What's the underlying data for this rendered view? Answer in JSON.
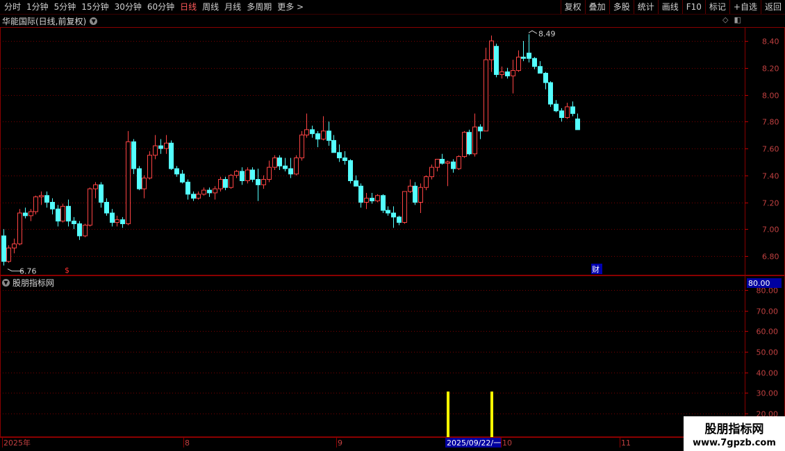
{
  "toolbar": {
    "tabs": [
      "分时",
      "1分钟",
      "5分钟",
      "15分钟",
      "30分钟",
      "60分钟",
      "日线",
      "周线",
      "月线",
      "多周期",
      "更多 >"
    ],
    "active_tab": "日线",
    "right_buttons": [
      "复权",
      "叠加",
      "多股",
      "统计",
      "画线",
      "F10",
      "标记",
      "+自选",
      "返回"
    ]
  },
  "main_chart": {
    "title": "华能国际(日线,前复权)",
    "y_ticks": [
      "8.40",
      "8.20",
      "8.00",
      "7.80",
      "7.60",
      "7.40",
      "7.20",
      "7.00",
      "6.80"
    ],
    "high_label": "8.49",
    "low_label": "6.76",
    "event_marker": "$",
    "finance_marker": "财"
  },
  "sub_chart": {
    "title": "股朋指标网",
    "current_value": "80.00",
    "y_ticks": [
      "80.00",
      "70.00",
      "60.00",
      "50.00",
      "40.00",
      "30.00",
      "20.00"
    ]
  },
  "x_axis": {
    "labels": [
      "2025年",
      "8",
      "9",
      "10",
      "11"
    ],
    "cursor_date": "2025/09/22/一"
  },
  "watermark": {
    "line1": "股朋指标网",
    "line2": "www.7gpzb.com"
  },
  "colors": {
    "background": "#000000",
    "up": "#ff4444",
    "down": "#54ffff",
    "grid": "#7a0000",
    "signal": "#ffff00"
  },
  "chart_data": {
    "type": "candlestick",
    "ylim": [
      6.76,
      8.49
    ],
    "candles": [
      [
        6.95,
        7.0,
        6.73,
        6.76
      ],
      [
        6.76,
        6.88,
        6.75,
        6.86
      ],
      [
        6.86,
        6.93,
        6.82,
        6.89
      ],
      [
        6.89,
        7.15,
        6.88,
        7.12
      ],
      [
        7.12,
        7.16,
        7.08,
        7.1
      ],
      [
        7.1,
        7.15,
        7.06,
        7.13
      ],
      [
        7.13,
        7.25,
        7.11,
        7.24
      ],
      [
        7.24,
        7.28,
        7.18,
        7.25
      ],
      [
        7.25,
        7.28,
        7.16,
        7.2
      ],
      [
        7.2,
        7.23,
        7.11,
        7.15
      ],
      [
        7.15,
        7.18,
        7.02,
        7.06
      ],
      [
        7.06,
        7.19,
        7.05,
        7.17
      ],
      [
        7.17,
        7.22,
        7.02,
        7.06
      ],
      [
        7.06,
        7.09,
        7.0,
        7.04
      ],
      [
        7.04,
        7.06,
        6.92,
        6.95
      ],
      [
        6.95,
        7.04,
        6.94,
        7.03
      ],
      [
        7.03,
        7.31,
        7.02,
        7.3
      ],
      [
        7.3,
        7.35,
        7.23,
        7.33
      ],
      [
        7.33,
        7.35,
        7.16,
        7.2
      ],
      [
        7.2,
        7.23,
        7.1,
        7.12
      ],
      [
        7.12,
        7.15,
        7.02,
        7.05
      ],
      [
        7.05,
        7.1,
        7.02,
        7.07
      ],
      [
        7.07,
        7.09,
        7.01,
        7.04
      ],
      [
        7.04,
        7.73,
        7.03,
        7.65
      ],
      [
        7.65,
        7.67,
        7.41,
        7.45
      ],
      [
        7.45,
        7.47,
        7.29,
        7.3
      ],
      [
        7.3,
        7.4,
        7.23,
        7.38
      ],
      [
        7.38,
        7.58,
        7.37,
        7.55
      ],
      [
        7.55,
        7.7,
        7.52,
        7.62
      ],
      [
        7.62,
        7.67,
        7.56,
        7.6
      ],
      [
        7.6,
        7.7,
        7.56,
        7.64
      ],
      [
        7.64,
        7.66,
        7.44,
        7.45
      ],
      [
        7.45,
        7.47,
        7.39,
        7.41
      ],
      [
        7.41,
        7.44,
        7.34,
        7.35
      ],
      [
        7.35,
        7.37,
        7.22,
        7.26
      ],
      [
        7.26,
        7.28,
        7.21,
        7.23
      ],
      [
        7.23,
        7.28,
        7.22,
        7.26
      ],
      [
        7.26,
        7.31,
        7.25,
        7.29
      ],
      [
        7.29,
        7.31,
        7.24,
        7.27
      ],
      [
        7.27,
        7.32,
        7.22,
        7.3
      ],
      [
        7.3,
        7.39,
        7.28,
        7.37
      ],
      [
        7.37,
        7.39,
        7.29,
        7.31
      ],
      [
        7.31,
        7.41,
        7.3,
        7.4
      ],
      [
        7.4,
        7.44,
        7.38,
        7.43
      ],
      [
        7.43,
        7.46,
        7.33,
        7.36
      ],
      [
        7.36,
        7.46,
        7.34,
        7.44
      ],
      [
        7.44,
        7.46,
        7.35,
        7.37
      ],
      [
        7.37,
        7.45,
        7.21,
        7.33
      ],
      [
        7.33,
        7.4,
        7.3,
        7.37
      ],
      [
        7.37,
        7.51,
        7.35,
        7.46
      ],
      [
        7.46,
        7.55,
        7.44,
        7.53
      ],
      [
        7.53,
        7.55,
        7.44,
        7.47
      ],
      [
        7.47,
        7.53,
        7.43,
        7.45
      ],
      [
        7.45,
        7.53,
        7.38,
        7.41
      ],
      [
        7.41,
        7.55,
        7.4,
        7.53
      ],
      [
        7.53,
        7.73,
        7.51,
        7.7
      ],
      [
        7.7,
        7.86,
        7.68,
        7.74
      ],
      [
        7.74,
        7.77,
        7.68,
        7.71
      ],
      [
        7.71,
        7.73,
        7.61,
        7.67
      ],
      [
        7.67,
        7.84,
        7.66,
        7.73
      ],
      [
        7.73,
        7.8,
        7.62,
        7.66
      ],
      [
        7.66,
        7.7,
        7.57,
        7.57
      ],
      [
        7.57,
        7.63,
        7.5,
        7.53
      ],
      [
        7.53,
        7.58,
        7.48,
        7.51
      ],
      [
        7.51,
        7.52,
        7.34,
        7.36
      ],
      [
        7.36,
        7.4,
        7.32,
        7.32
      ],
      [
        7.32,
        7.34,
        7.16,
        7.2
      ],
      [
        7.2,
        7.27,
        7.15,
        7.23
      ],
      [
        7.23,
        7.27,
        7.19,
        7.21
      ],
      [
        7.21,
        7.26,
        7.2,
        7.25
      ],
      [
        7.25,
        7.26,
        7.12,
        7.14
      ],
      [
        7.14,
        7.17,
        7.1,
        7.12
      ],
      [
        7.12,
        7.17,
        7.01,
        7.09
      ],
      [
        7.09,
        7.1,
        7.03,
        7.05
      ],
      [
        7.05,
        7.28,
        7.04,
        7.28
      ],
      [
        7.28,
        7.37,
        7.27,
        7.32
      ],
      [
        7.32,
        7.35,
        7.18,
        7.2
      ],
      [
        7.2,
        7.34,
        7.12,
        7.31
      ],
      [
        7.31,
        7.4,
        7.29,
        7.39
      ],
      [
        7.39,
        7.48,
        7.37,
        7.46
      ],
      [
        7.46,
        7.52,
        7.43,
        7.52
      ],
      [
        7.52,
        7.56,
        7.48,
        7.49
      ],
      [
        7.49,
        7.51,
        7.32,
        7.5
      ],
      [
        7.5,
        7.52,
        7.42,
        7.45
      ],
      [
        7.45,
        7.55,
        7.44,
        7.54
      ],
      [
        7.54,
        7.73,
        7.53,
        7.72
      ],
      [
        7.72,
        7.74,
        7.55,
        7.56
      ],
      [
        7.56,
        7.86,
        7.54,
        7.76
      ],
      [
        7.76,
        7.78,
        7.67,
        7.73
      ],
      [
        7.73,
        8.35,
        7.97,
        8.26
      ],
      [
        8.26,
        8.44,
        8.17,
        8.4
      ],
      [
        8.36,
        8.38,
        8.13,
        8.15
      ],
      [
        8.15,
        8.21,
        8.12,
        8.17
      ],
      [
        8.17,
        8.2,
        8.12,
        8.14
      ],
      [
        8.14,
        8.26,
        8.01,
        8.18
      ],
      [
        8.18,
        8.33,
        8.17,
        8.28
      ],
      [
        8.28,
        8.4,
        8.25,
        8.27
      ],
      [
        8.31,
        8.45,
        8.24,
        8.27
      ],
      [
        8.27,
        8.28,
        8.19,
        8.21
      ],
      [
        8.21,
        8.25,
        8.16,
        8.16
      ],
      [
        8.16,
        8.17,
        8.04,
        8.09
      ],
      [
        8.09,
        8.1,
        7.91,
        7.93
      ],
      [
        7.93,
        7.96,
        7.87,
        7.88
      ],
      [
        7.88,
        7.9,
        7.8,
        7.83
      ],
      [
        7.83,
        7.94,
        7.82,
        7.91
      ],
      [
        7.91,
        7.95,
        7.84,
        7.86
      ],
      [
        7.82,
        7.86,
        7.75,
        7.74
      ]
    ],
    "indicator": {
      "name": "股朋指标网",
      "ylim": [
        15,
        90
      ],
      "signals": [
        "2025/09/22",
        "2025/09/26"
      ]
    }
  }
}
